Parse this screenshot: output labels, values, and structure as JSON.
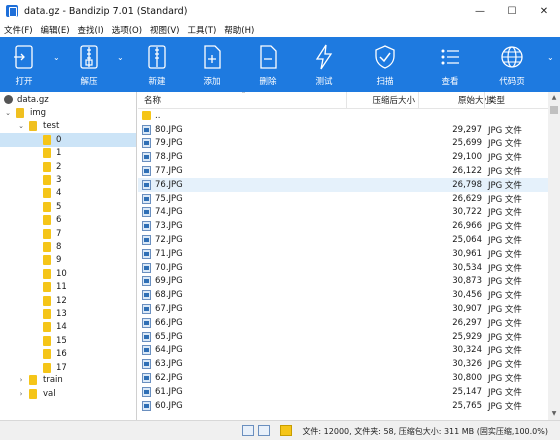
{
  "window": {
    "title": "data.gz - Bandizip 7.01 (Standard)",
    "minimize": "—",
    "maximize": "☐",
    "close": "✕"
  },
  "menu": [
    "文件(F)",
    "编辑(E)",
    "查找(I)",
    "选项(O)",
    "视图(V)",
    "工具(T)",
    "帮助(H)"
  ],
  "toolbar": {
    "open": "打开",
    "extract": "解压",
    "new": "新建",
    "add": "添加",
    "delete": "删除",
    "test": "测试",
    "scan": "扫描",
    "view": "查看",
    "codepage": "代码页",
    "dropdown_arrow": "⌄"
  },
  "tree": {
    "root": "data.gz",
    "img": "img",
    "test": "test",
    "children": [
      "0",
      "1",
      "2",
      "3",
      "4",
      "5",
      "6",
      "7",
      "8",
      "9",
      "10",
      "11",
      "12",
      "13",
      "14",
      "15",
      "16",
      "17"
    ],
    "train": "train",
    "val": "val"
  },
  "list": {
    "headers": {
      "name": "名称",
      "compressed": "压缩后大小",
      "original": "原始大小",
      "type": "类型"
    },
    "up": "..",
    "rows": [
      {
        "name": "80.JPG",
        "size": "29,297",
        "type": "JPG 文件"
      },
      {
        "name": "79.JPG",
        "size": "25,699",
        "type": "JPG 文件"
      },
      {
        "name": "78.JPG",
        "size": "29,100",
        "type": "JPG 文件"
      },
      {
        "name": "77.JPG",
        "size": "26,122",
        "type": "JPG 文件"
      },
      {
        "name": "76.JPG",
        "size": "26,798",
        "type": "JPG 文件"
      },
      {
        "name": "75.JPG",
        "size": "26,629",
        "type": "JPG 文件"
      },
      {
        "name": "74.JPG",
        "size": "30,722",
        "type": "JPG 文件"
      },
      {
        "name": "73.JPG",
        "size": "26,966",
        "type": "JPG 文件"
      },
      {
        "name": "72.JPG",
        "size": "25,064",
        "type": "JPG 文件"
      },
      {
        "name": "71.JPG",
        "size": "30,961",
        "type": "JPG 文件"
      },
      {
        "name": "70.JPG",
        "size": "30,534",
        "type": "JPG 文件"
      },
      {
        "name": "69.JPG",
        "size": "30,873",
        "type": "JPG 文件"
      },
      {
        "name": "68.JPG",
        "size": "30,456",
        "type": "JPG 文件"
      },
      {
        "name": "67.JPG",
        "size": "30,907",
        "type": "JPG 文件"
      },
      {
        "name": "66.JPG",
        "size": "26,297",
        "type": "JPG 文件"
      },
      {
        "name": "65.JPG",
        "size": "25,929",
        "type": "JPG 文件"
      },
      {
        "name": "64.JPG",
        "size": "30,324",
        "type": "JPG 文件"
      },
      {
        "name": "63.JPG",
        "size": "30,326",
        "type": "JPG 文件"
      },
      {
        "name": "62.JPG",
        "size": "30,800",
        "type": "JPG 文件"
      },
      {
        "name": "61.JPG",
        "size": "25,147",
        "type": "JPG 文件"
      },
      {
        "name": "60.JPG",
        "size": "25,765",
        "type": "JPG 文件"
      }
    ]
  },
  "statusbar": {
    "text": "文件: 12000, 文件夹: 58, 压缩包大小: 311 MB (固实压缩,100.0%)"
  },
  "colors": {
    "toolbar": "#1e7ae0",
    "selected": "#cce4f7",
    "hover": "#e5f1fb",
    "folder": "#f5c518"
  }
}
